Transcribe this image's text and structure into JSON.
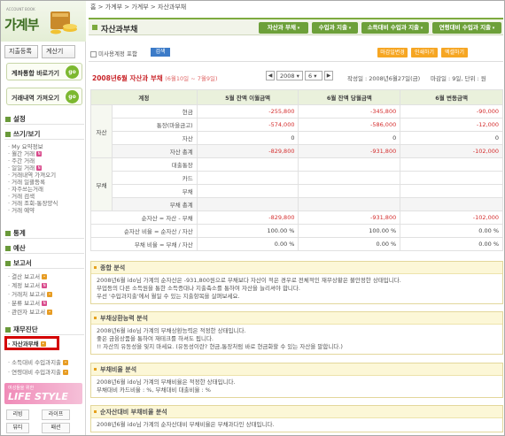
{
  "sidebar": {
    "logo_small": "ACCOUNT BOOK",
    "logo": "가계부",
    "btn_entry": "지출등록",
    "btn_calc": "계산기",
    "go1": "계좌통합 바로가기",
    "go2": "거래내역 가져오기",
    "go_label": "go",
    "sections": {
      "settings": "설정",
      "write": "쓰기/보기",
      "stats": "통계",
      "budget": "예산",
      "report": "보고서",
      "diag": "재무진단"
    },
    "write_items": [
      "My 요약정보",
      "월간 거래",
      "주간 거래",
      "일일 거래",
      "거래내역 가져오기",
      "거래 일괄등록",
      "자주쓰는거래",
      "거래 검색",
      "거래 조회-통장양식",
      "거래 예약"
    ],
    "report_items": [
      "결산 보고서",
      "계정 보고서",
      "거래처 보고서",
      "분류 보고서",
      "관련자 보고서"
    ],
    "diag_items": [
      "자산과부채",
      "소득대비 수입과지출",
      "연령대비 수입과지출"
    ],
    "life_a": "여성들을 위한",
    "life_b": "LIFE STYLE",
    "life_btns": [
      "리빙",
      "라이프",
      "뷰티",
      "패션"
    ]
  },
  "breadcrumb": "홈 > 가계부 > 가계부 > 자산과부채",
  "title": "자산과부채",
  "tabs": [
    "자산과 부채",
    "수입과 지출",
    "소득대비 수입과 지출",
    "연령대비 수입과 지출"
  ],
  "filter": {
    "checkbox_label": "미사용계정 포함",
    "search": "검색"
  },
  "actions": [
    "마감일변경",
    "인쇄하기",
    "엑셀하기"
  ],
  "nav": {
    "year": "2008",
    "month": "6",
    "prev": "◀",
    "next": "▶"
  },
  "period": {
    "title": "2008년6월 자산과 부채",
    "range": "(6월10일 ~ 7월9일)"
  },
  "meta": {
    "written": "작성일 : 2008년6월27일(금)",
    "closing": "마감일 : 9일, 단위 : 원"
  },
  "table": {
    "headers": [
      "계정",
      "5월 잔액 이월금액",
      "6월 잔액 당월금액",
      "6월 변동금액"
    ],
    "asset_label": "자산",
    "debt_label": "부채",
    "assets": [
      {
        "name": "현금",
        "c1": "-255,800",
        "c2": "-345,800",
        "c3": "-90,000"
      },
      {
        "name": "통장(마을금고)",
        "c1": "-574,000",
        "c2": "-586,000",
        "c3": "-12,000"
      },
      {
        "name": "자산",
        "c1": "0",
        "c2": "0",
        "c3": "0"
      },
      {
        "name": "자산 총계",
        "c1": "-829,800",
        "c2": "-931,800",
        "c3": "-102,000"
      }
    ],
    "debts": [
      {
        "name": "대출통장",
        "c1": "",
        "c2": "",
        "c3": ""
      },
      {
        "name": "카드",
        "c1": "",
        "c2": "",
        "c3": ""
      },
      {
        "name": "부채",
        "c1": "",
        "c2": "",
        "c3": ""
      },
      {
        "name": "부채 총계",
        "c1": "",
        "c2": "",
        "c3": ""
      }
    ],
    "summary": [
      {
        "name": "순자산 = 자산 - 부채",
        "c1": "-829,800",
        "c2": "-931,800",
        "c3": "-102,000"
      },
      {
        "name": "순자산 비율 = 순자산 / 자산",
        "c1": "100.00 %",
        "c2": "100.00 %",
        "c3": "0.00 %"
      },
      {
        "name": "부채 비율 = 부채 / 자산",
        "c1": "0.00 %",
        "c2": "0.00 %",
        "c3": "0.00 %"
      }
    ]
  },
  "analysis": [
    {
      "title": "종합 분석",
      "lines": [
        "2008년6월 ido님 가계의 순자산은 -931,800원으로 부채보다 자산이 적은 경우로 전체적인 재무상황은 불안정한 상태입니다.",
        "부업등의 다른 소득원을 통한 소득증대나 지출축소를 통하여 자산을 늘리셔야 합니다.",
        "우선 '수입과지출'에서 월일 수 있는 지출항목을 살펴보세요."
      ]
    },
    {
      "title": "부채상환능력 분석",
      "lines": [
        "2008년6월 ido님 가계의 부채상환능력은 적정한 상태입니다.",
        "좋은 금융상품을 통하여 재테크를 하셔도 됩니다.",
        "!! 자산의 유동성을 잊지 마세요. (유동성이란? 현금,통장처럼 바로 현금화할 수 있는 자산을 말합니다.)"
      ]
    },
    {
      "title": "부채비율 분석",
      "lines": [
        "2008년6월 ido님 가계의 부채비율은 적정한 상태입니다.",
        "부채대비 카드비율 : %, 부채대비 대출비율 : %"
      ]
    },
    {
      "title": "순자산대비 부채비율 분석",
      "lines": [
        "2008년6월 ido님 가계의 순자산대비 부채비율은 부채과다인 상태입니다."
      ]
    }
  ]
}
